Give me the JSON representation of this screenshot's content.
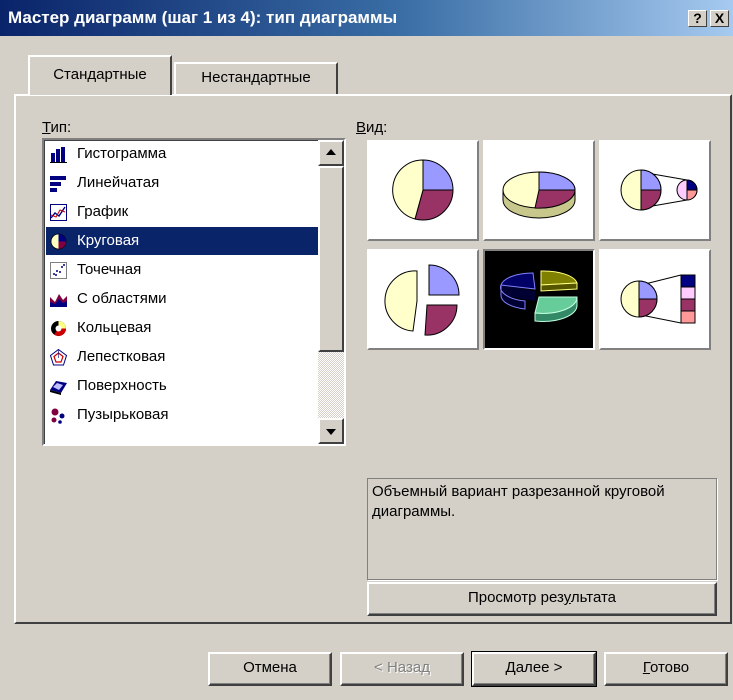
{
  "window": {
    "title": "Мастер диаграмм (шаг 1 из 4): тип диаграммы",
    "help_label": "?",
    "close_label": "X"
  },
  "tabs": [
    {
      "label": "Стандартные"
    },
    {
      "label": "Нестандартные"
    }
  ],
  "type_section": {
    "label_prefix": "Т",
    "label_rest": "ип:"
  },
  "view_section": {
    "label_prefix": "В",
    "label_rest": "ид:"
  },
  "chart_types": [
    {
      "label": "Гистограмма",
      "icon": "column-chart-icon"
    },
    {
      "label": "Линейчатая",
      "icon": "bar-chart-icon"
    },
    {
      "label": "График",
      "icon": "line-chart-icon"
    },
    {
      "label": "Круговая",
      "icon": "pie-chart-icon",
      "selected": true
    },
    {
      "label": "Точечная",
      "icon": "scatter-chart-icon"
    },
    {
      "label": "С областями",
      "icon": "area-chart-icon"
    },
    {
      "label": "Кольцевая",
      "icon": "doughnut-chart-icon"
    },
    {
      "label": "Лепестковая",
      "icon": "radar-chart-icon"
    },
    {
      "label": "Поверхность",
      "icon": "surface-chart-icon"
    },
    {
      "label": "Пузырьковая",
      "icon": "bubble-chart-icon"
    }
  ],
  "subtypes": [
    {
      "name": "pie",
      "selected": false
    },
    {
      "name": "pie-3d",
      "selected": false
    },
    {
      "name": "pie-of-pie",
      "selected": false
    },
    {
      "name": "exploded-pie",
      "selected": false
    },
    {
      "name": "exploded-pie-3d",
      "selected": true
    },
    {
      "name": "bar-of-pie",
      "selected": false
    }
  ],
  "description": "Объемный вариант разрезанной круговой диаграммы.",
  "preview_button": {
    "before": "Просмотр рез",
    "underlined": "у",
    "after": "льтата"
  },
  "buttons": {
    "cancel": "Отмена",
    "back": "< Назад",
    "next_prefix": "Д",
    "next_rest": "алее >",
    "finish_prefix": "Г",
    "finish_rest": "отово"
  },
  "colors": {
    "title_bar": "#0a246a",
    "face": "#d4d0c8",
    "selection": "#0a246a"
  }
}
